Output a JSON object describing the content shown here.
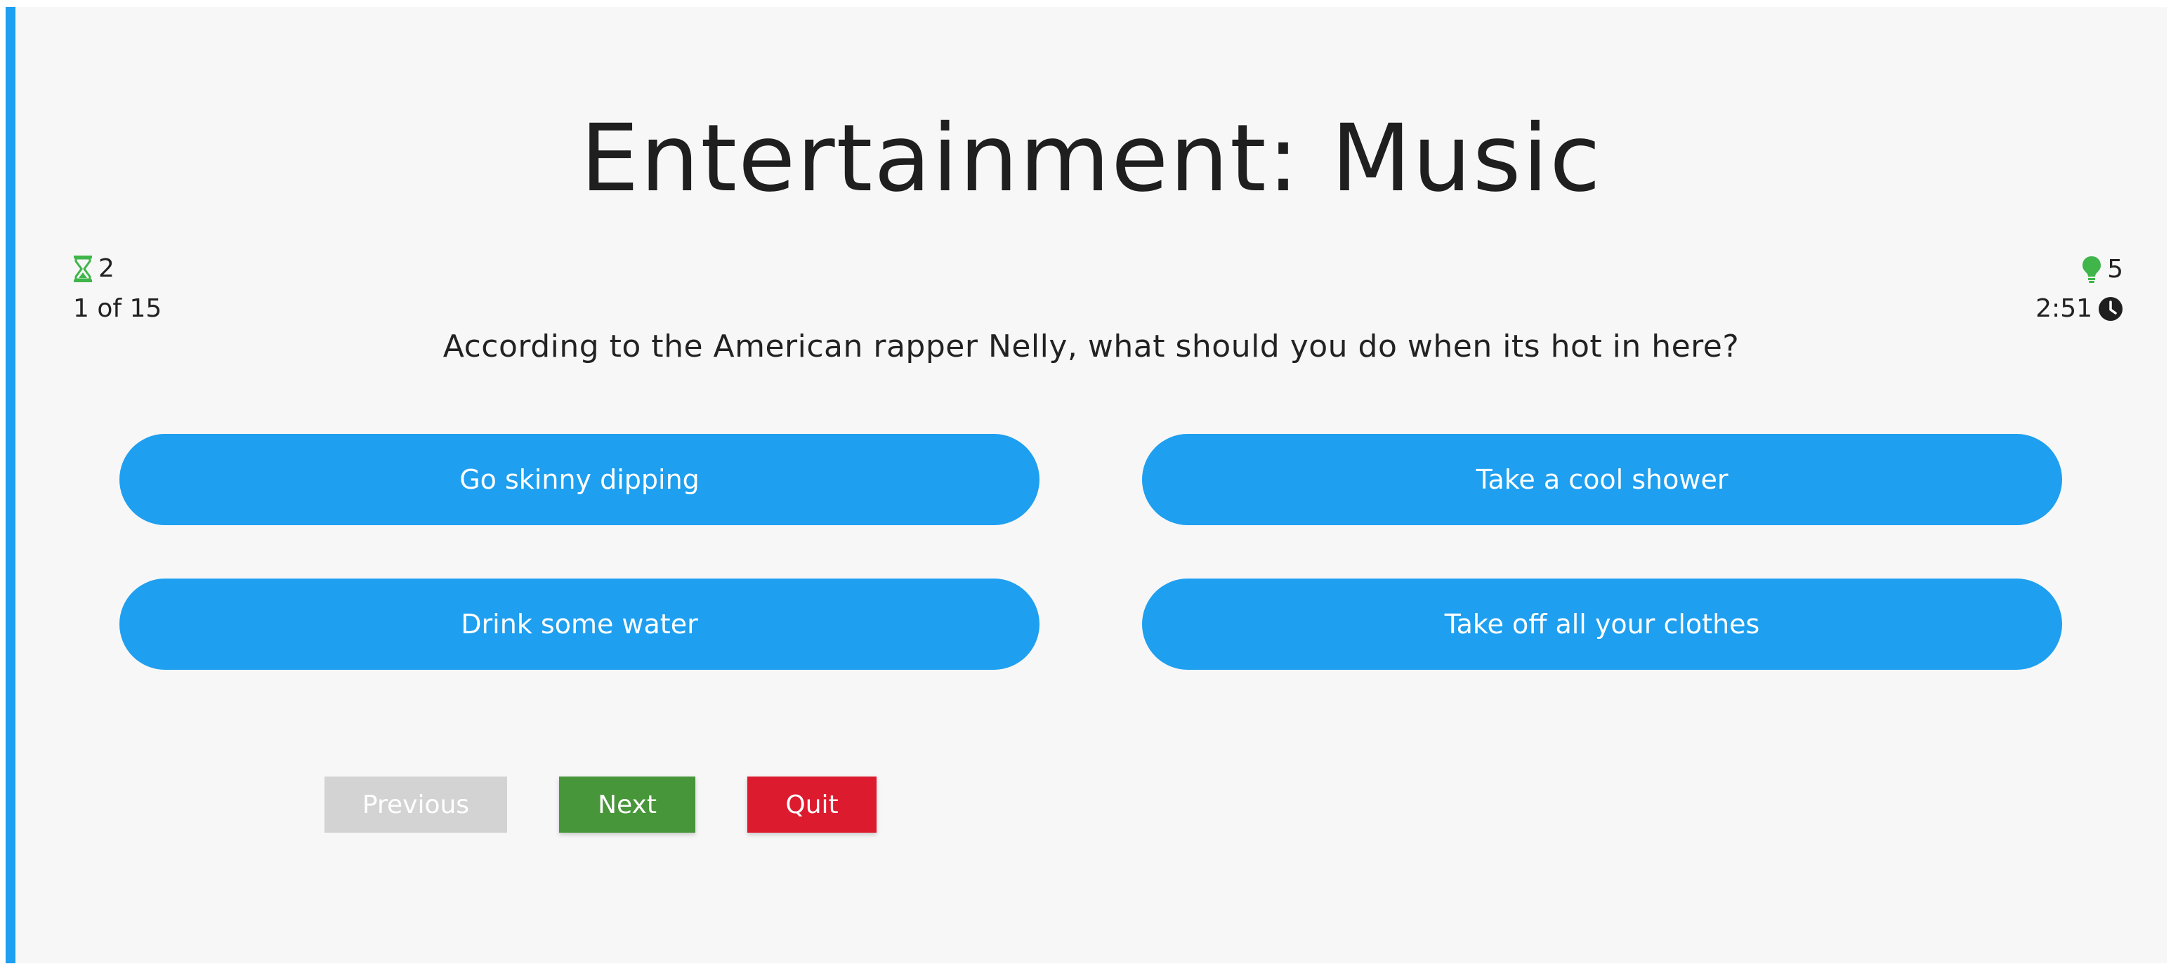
{
  "quiz": {
    "category": "Entertainment: Music",
    "question": "According to the American rapper Nelly, what should you do when its hot in here?",
    "progress_text": "1 of 15",
    "hints_remaining": "2",
    "fifty_fifty_remaining": "5",
    "time_remaining": "2:51",
    "options": [
      {
        "label": "Go skinny dipping"
      },
      {
        "label": "Take a cool shower"
      },
      {
        "label": "Drink some water"
      },
      {
        "label": "Take off all your clothes"
      }
    ]
  },
  "nav": {
    "previous_label": "Previous",
    "next_label": "Next",
    "quit_label": "Quit"
  },
  "icons": {
    "hints": "hourglass-icon",
    "fifty_fifty": "lightbulb-icon",
    "timer": "clock-icon"
  },
  "colors": {
    "accent": "#1e9ff0",
    "next": "#48963a",
    "quit": "#dc1b2e",
    "disabled": "#d3d3d3",
    "icon_green": "#3fb54a"
  }
}
